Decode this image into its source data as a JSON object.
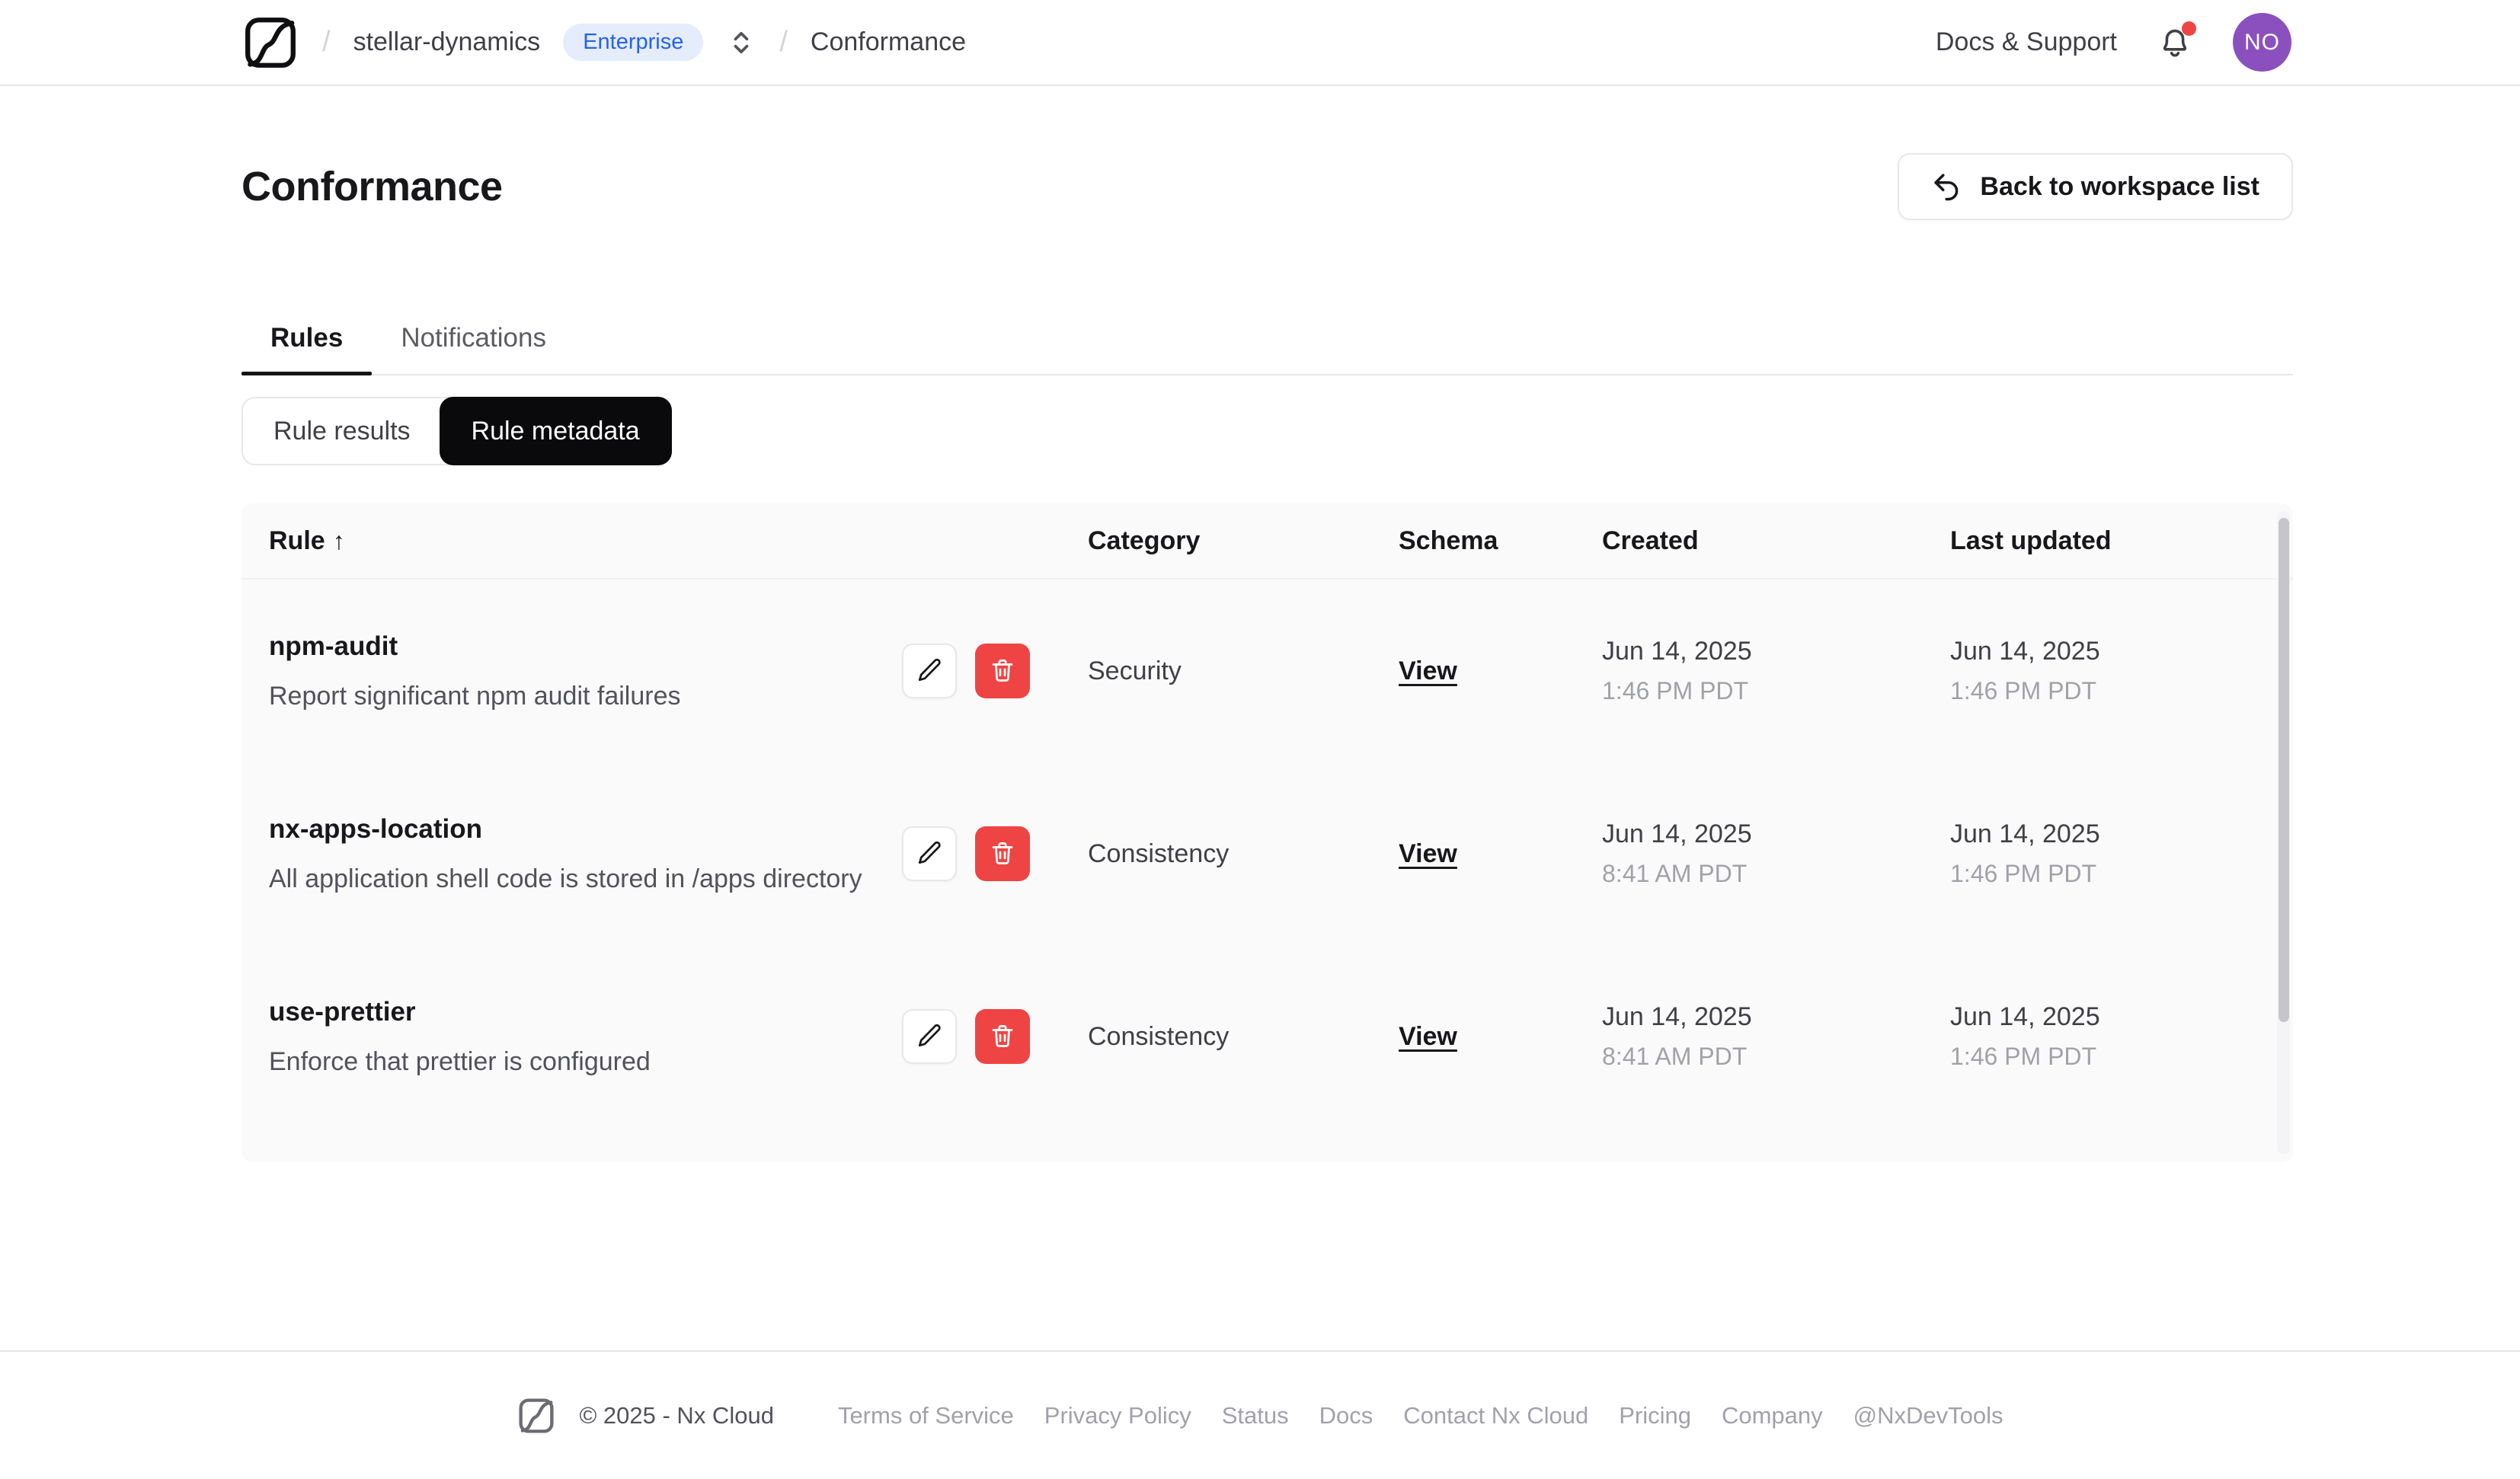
{
  "colors": {
    "border": "#e7e8ec",
    "panel": "#fafafa",
    "red": "#ef4444",
    "purple": "#8c50be",
    "badge-bg": "#e5ecfb",
    "badge-text": "#2563eb",
    "black-btn": "#0a0a0c"
  },
  "header": {
    "breadcrumb": {
      "separator": "/",
      "workspace": "stellar-dynamics",
      "badge": "Enterprise",
      "page": "Conformance"
    },
    "docs_support_label": "Docs & Support",
    "avatar_initials": "NO"
  },
  "page": {
    "title": "Conformance",
    "back_button_label": "Back to workspace list"
  },
  "tabs": [
    {
      "label": "Rules",
      "active": true
    },
    {
      "label": "Notifications",
      "active": false
    }
  ],
  "segmented": [
    {
      "label": "Rule results",
      "active": false
    },
    {
      "label": "Rule metadata",
      "active": true
    }
  ],
  "table": {
    "columns": [
      "Rule",
      "Category",
      "Schema",
      "Created",
      "Last updated"
    ],
    "sort_indicator": "↑",
    "rows": [
      {
        "name": "npm-audit",
        "description": "Report significant npm audit failures",
        "category": "Security",
        "schema_label": "View",
        "created_date": "Jun 14, 2025",
        "created_time": "1:46 PM PDT",
        "updated_date": "Jun 14, 2025",
        "updated_time": "1:46 PM PDT"
      },
      {
        "name": "nx-apps-location",
        "description": "All application shell code is stored in /apps directory",
        "category": "Consistency",
        "schema_label": "View",
        "created_date": "Jun 14, 2025",
        "created_time": "8:41 AM PDT",
        "updated_date": "Jun 14, 2025",
        "updated_time": "1:46 PM PDT"
      },
      {
        "name": "use-prettier",
        "description": "Enforce that prettier is configured",
        "category": "Consistency",
        "schema_label": "View",
        "created_date": "Jun 14, 2025",
        "created_time": "8:41 AM PDT",
        "updated_date": "Jun 14, 2025",
        "updated_time": "1:46 PM PDT"
      }
    ]
  },
  "footer": {
    "copyright": "© 2025 - Nx Cloud",
    "links": [
      "Terms of Service",
      "Privacy Policy",
      "Status",
      "Docs",
      "Contact Nx Cloud",
      "Pricing",
      "Company",
      "@NxDevTools"
    ]
  }
}
